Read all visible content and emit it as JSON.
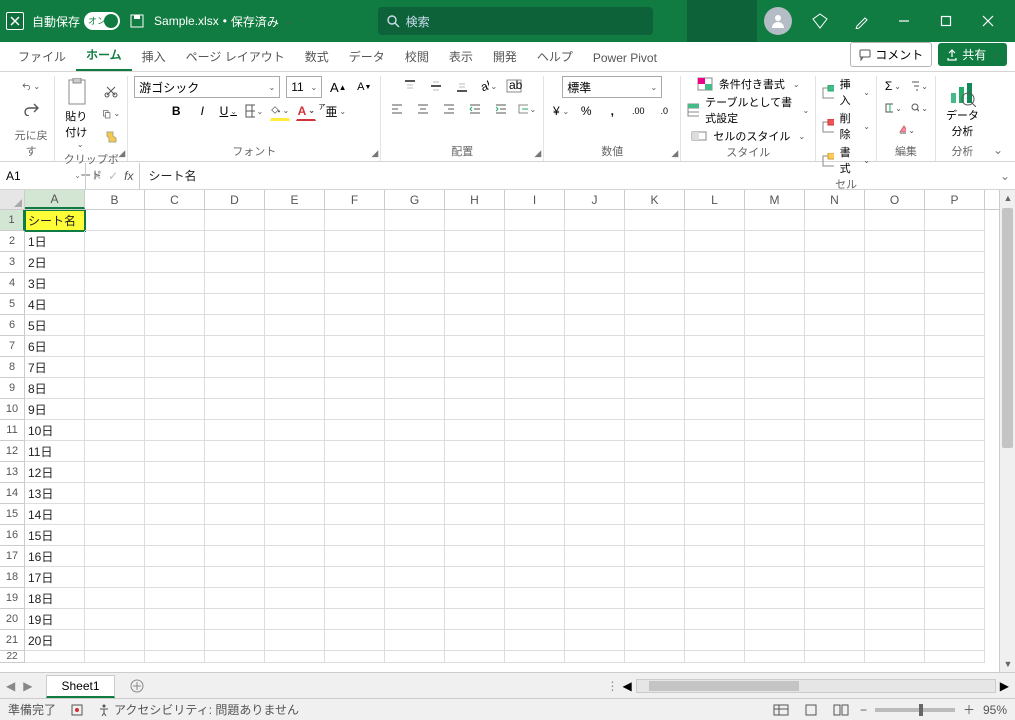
{
  "title_bar": {
    "auto_save_label": "自動保存",
    "auto_save_state": "オン",
    "filename": "Sample.xlsx",
    "save_status": "保存済み",
    "search_placeholder": "検索"
  },
  "tabs": {
    "file": "ファイル",
    "home": "ホーム",
    "insert": "挿入",
    "page_layout": "ページ レイアウト",
    "formulas": "数式",
    "data": "データ",
    "review": "校閲",
    "view": "表示",
    "developer": "開発",
    "help": "ヘルプ",
    "power_pivot": "Power Pivot",
    "comments": "コメント",
    "share": "共有"
  },
  "ribbon": {
    "undo_group": "元に戻す",
    "clipboard_group": "クリップボード",
    "paste": "貼り付け",
    "font_group": "フォント",
    "font_name": "游ゴシック",
    "font_size": "11",
    "alignment_group": "配置",
    "number_group": "数値",
    "number_format": "標準",
    "styles_group": "スタイル",
    "cond_fmt": "条件付き書式",
    "table_fmt": "テーブルとして書式設定",
    "cell_styles": "セルのスタイル",
    "cells_group": "セル",
    "ins": "挿入",
    "del": "削除",
    "fmt": "書式",
    "editing_group": "編集",
    "analysis_group": "分析",
    "data_analysis": "データ\n分析"
  },
  "name_box": "A1",
  "formula_value": "シート名",
  "columns": [
    "A",
    "B",
    "C",
    "D",
    "E",
    "F",
    "G",
    "H",
    "I",
    "J",
    "K",
    "L",
    "M",
    "N",
    "O",
    "P"
  ],
  "rows": [
    {
      "n": 1,
      "a": "シート名"
    },
    {
      "n": 2,
      "a": "1日"
    },
    {
      "n": 3,
      "a": "2日"
    },
    {
      "n": 4,
      "a": "3日"
    },
    {
      "n": 5,
      "a": "4日"
    },
    {
      "n": 6,
      "a": "5日"
    },
    {
      "n": 7,
      "a": "6日"
    },
    {
      "n": 8,
      "a": "7日"
    },
    {
      "n": 9,
      "a": "8日"
    },
    {
      "n": 10,
      "a": "9日"
    },
    {
      "n": 11,
      "a": "10日"
    },
    {
      "n": 12,
      "a": "11日"
    },
    {
      "n": 13,
      "a": "12日"
    },
    {
      "n": 14,
      "a": "13日"
    },
    {
      "n": 15,
      "a": "14日"
    },
    {
      "n": 16,
      "a": "15日"
    },
    {
      "n": 17,
      "a": "16日"
    },
    {
      "n": 18,
      "a": "17日"
    },
    {
      "n": 19,
      "a": "18日"
    },
    {
      "n": 20,
      "a": "19日"
    },
    {
      "n": 21,
      "a": "20日"
    }
  ],
  "sheet_bar": {
    "sheet1": "Sheet1"
  },
  "status": {
    "ready": "準備完了",
    "accessibility": "アクセシビリティ: 問題ありません",
    "zoom": "95%"
  }
}
